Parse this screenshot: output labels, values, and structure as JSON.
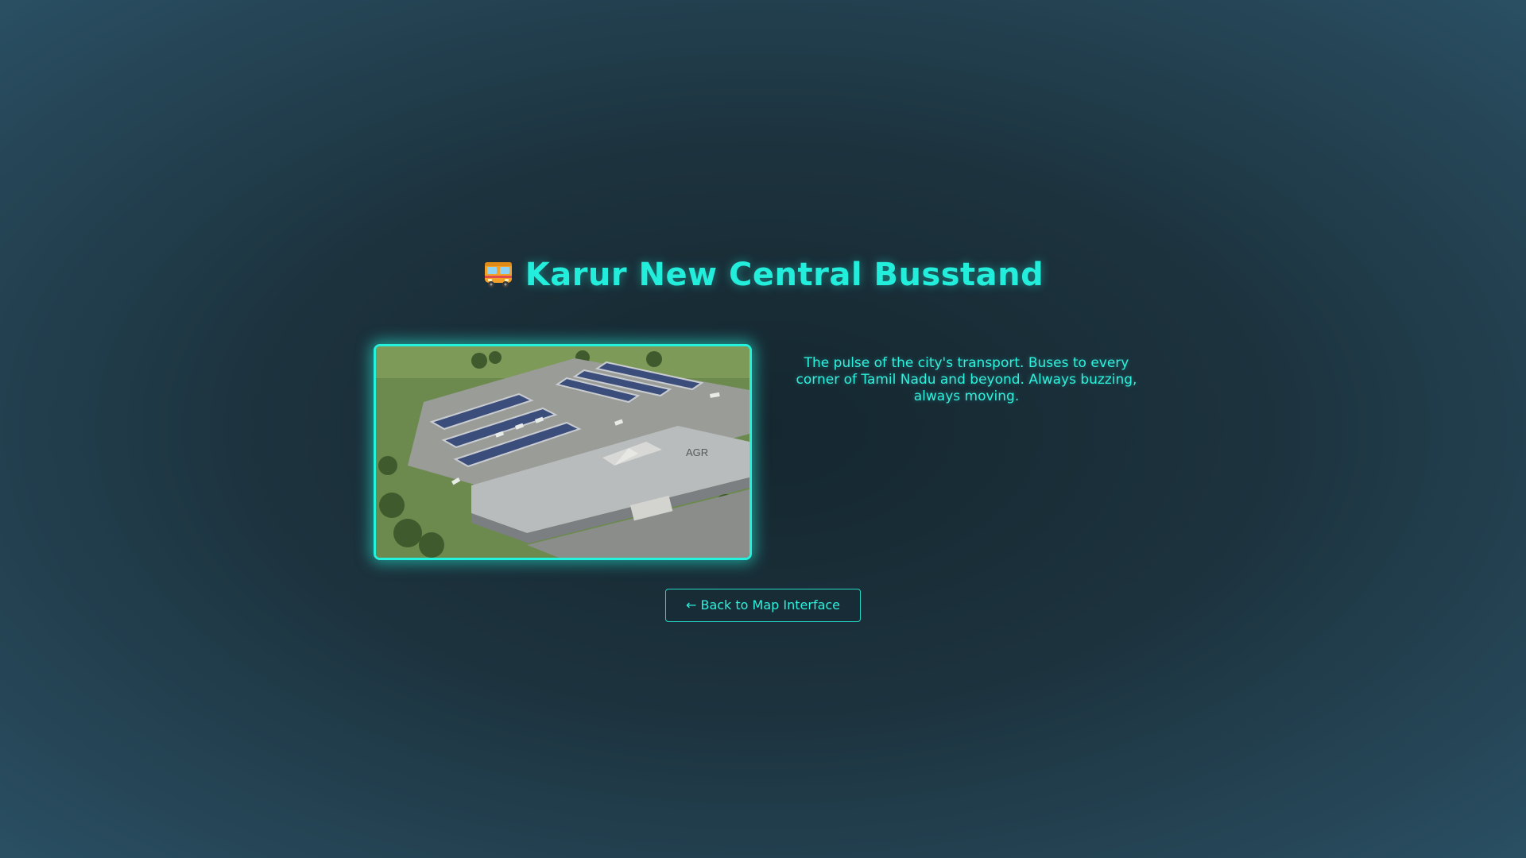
{
  "page": {
    "title": "Karur New Central Busstand",
    "title_icon": "bus-emoji-icon",
    "description": "The pulse of the city's transport. Buses to every corner of Tamil Nadu and beyond. Always buzzing, always moving.",
    "photo": {
      "subject": "aerial-view-bus-terminal",
      "building_sign": "AGR"
    },
    "back_button_label": "← Back to Map Interface"
  },
  "colors": {
    "accent": "#22eedb",
    "background_center": "#152730",
    "background_edge": "#2a4f63"
  }
}
